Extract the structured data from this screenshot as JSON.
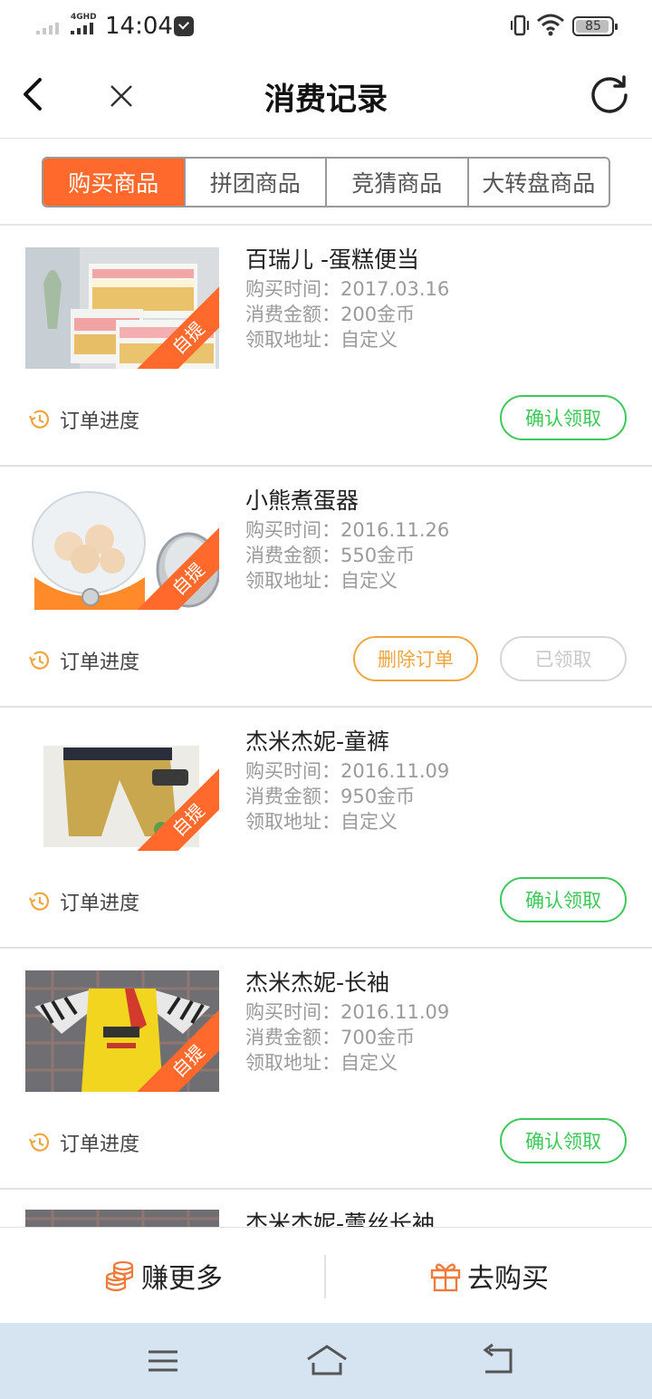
{
  "status_bar": {
    "time": "14:04",
    "network": "4GHD",
    "battery": "85"
  },
  "header": {
    "title": "消费记录",
    "back_icon": "chevron-left-icon",
    "close_icon": "close-icon",
    "refresh_icon": "refresh-icon"
  },
  "tabs": [
    {
      "label": "购买商品",
      "active": true
    },
    {
      "label": "拼团商品",
      "active": false
    },
    {
      "label": "竞猜商品",
      "active": false
    },
    {
      "label": "大转盘商品",
      "active": false
    }
  ],
  "colors": {
    "accent": "#ff6a2c",
    "green": "#3ec85a",
    "orange_btn": "#f0a640",
    "text_dark": "#222222",
    "text_gray": "#9a9a9a",
    "nav_bar_bg": "#d6e4f2"
  },
  "orders": [
    {
      "name": "百瑞儿 -蛋糕便当",
      "time_label": "购买时间：",
      "time": "2017.03.16",
      "amount_label": "消费金额：",
      "amount": "200金币",
      "address_label": "领取地址：",
      "address": "自定义",
      "tag": "自提",
      "progress": "订单进度",
      "action": "确认领取"
    },
    {
      "name": "小熊煮蛋器",
      "time_label": "购买时间：",
      "time": "2016.11.26",
      "amount_label": "消费金额：",
      "amount": "550金币",
      "address_label": "领取地址：",
      "address": "自定义",
      "tag": "自提",
      "progress": "订单进度",
      "delete": "删除订单",
      "action": "已领取"
    },
    {
      "name": "杰米杰妮-童裤",
      "time_label": "购买时间：",
      "time": "2016.11.09",
      "amount_label": "消费金额：",
      "amount": "950金币",
      "address_label": "领取地址：",
      "address": "自定义",
      "tag": "自提",
      "progress": "订单进度",
      "action": "确认领取"
    },
    {
      "name": "杰米杰妮-长袖",
      "time_label": "购买时间：",
      "time": "2016.11.09",
      "amount_label": "消费金额：",
      "amount": "700金币",
      "address_label": "领取地址：",
      "address": "自定义",
      "tag": "自提",
      "progress": "订单进度",
      "action": "确认领取"
    },
    {
      "name": "杰米杰妮-蕾丝长袖"
    }
  ],
  "bottom_bar": {
    "earn_label": "赚更多",
    "earn_icon": "coins-icon",
    "buy_label": "去购买",
    "buy_icon": "gift-icon"
  },
  "nav_bar": {
    "menu_icon": "menu-icon",
    "home_icon": "home-icon",
    "back_icon": "return-icon"
  }
}
